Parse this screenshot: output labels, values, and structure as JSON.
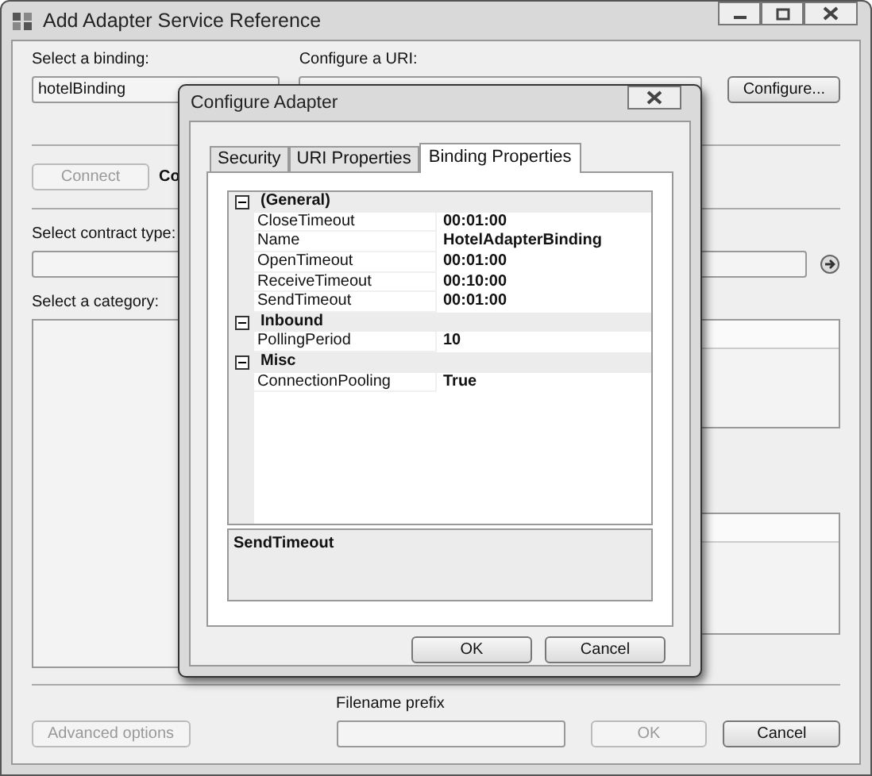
{
  "window": {
    "title": "Add Adapter Service Reference"
  },
  "binding": {
    "label": "Select a binding:",
    "value": "hotelBinding"
  },
  "uri": {
    "label": "Configure a URI:"
  },
  "configure_button": {
    "label": "Configure...",
    "disabled": false
  },
  "connect_button": {
    "label": "Connect",
    "disabled": true
  },
  "connect_status": "Co",
  "contract": {
    "label": "Select contract type:"
  },
  "category": {
    "label": "Select a category:"
  },
  "filename_prefix": {
    "label": "Filename prefix"
  },
  "footer_buttons": [
    {
      "label": "Advanced options",
      "disabled": true
    },
    {
      "label": "OK",
      "disabled": true
    },
    {
      "label": "Cancel",
      "disabled": false
    }
  ],
  "dialog": {
    "title": "Configure Adapter",
    "tabs": [
      {
        "label": "Security",
        "selected": false
      },
      {
        "label": "URI Properties",
        "selected": false
      },
      {
        "label": "Binding Properties",
        "selected": true
      }
    ],
    "categories": [
      {
        "name": "(General)",
        "expanded": true,
        "properties": [
          {
            "name": "CloseTimeout",
            "value": "00:01:00"
          },
          {
            "name": "Name",
            "value": "HotelAdapterBinding"
          },
          {
            "name": "OpenTimeout",
            "value": "00:01:00"
          },
          {
            "name": "ReceiveTimeout",
            "value": "00:10:00"
          },
          {
            "name": "SendTimeout",
            "value": "00:01:00"
          }
        ]
      },
      {
        "name": "Inbound",
        "expanded": true,
        "properties": [
          {
            "name": "PollingPeriod",
            "value": "10"
          }
        ]
      },
      {
        "name": "Misc",
        "expanded": true,
        "properties": [
          {
            "name": "ConnectionPooling",
            "value": "True"
          }
        ]
      }
    ],
    "description": "SendTimeout",
    "buttons": [
      {
        "label": "OK"
      },
      {
        "label": "Cancel"
      }
    ]
  }
}
